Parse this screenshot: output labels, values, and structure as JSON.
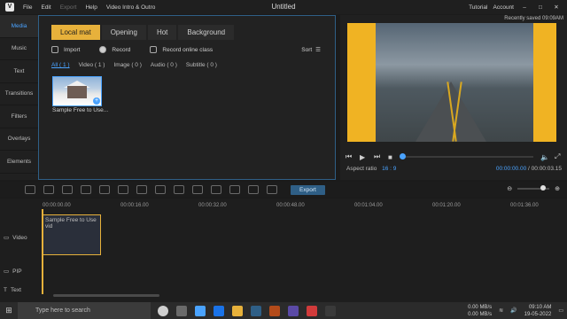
{
  "window": {
    "title": "Untitled",
    "menu": [
      "File",
      "Edit",
      "Export",
      "Help",
      "Video Intro & Outro"
    ],
    "right_links": [
      "Tutorial",
      "Account"
    ]
  },
  "left_nav": [
    "Media",
    "Music",
    "Text",
    "Transitions",
    "Filters",
    "Overlays",
    "Elements"
  ],
  "media": {
    "tabs": [
      "Local mat",
      "Opening",
      "Hot",
      "Background"
    ],
    "actions": {
      "import": "Import",
      "record": "Record",
      "record_online": "Record online class",
      "sort": "Sort"
    },
    "filters": [
      "All ( 1 )",
      "Video ( 1 )",
      "Image ( 0 )",
      "Audio ( 0 )",
      "Subtitle ( 0 )"
    ],
    "items": [
      {
        "label": "Sample Free to Use..."
      }
    ]
  },
  "preview": {
    "saved": "Recently saved 09:09AM",
    "aspect_label": "Aspect ratio",
    "aspect_value": "16 : 9",
    "current_time": "00:00:00.00",
    "total_time": "00:00:03.15"
  },
  "toolbar": {
    "export_label": "Export"
  },
  "timeline": {
    "ticks": [
      "00:00:00.00",
      "00:00:16.00",
      "00:00:32.00",
      "00:00:48.00",
      "00:01:04.00",
      "00:01:20.00",
      "00:01:36.00"
    ],
    "tracks": [
      "Video",
      "PIP",
      "Text"
    ],
    "clip_label": "Sample Free to Use vid"
  },
  "taskbar": {
    "search_placeholder": "Type here to search",
    "net_up": "0.00 MB/s",
    "net_down": "0.00 MB/s",
    "time": "09:10 AM",
    "date": "19-05-2022"
  }
}
